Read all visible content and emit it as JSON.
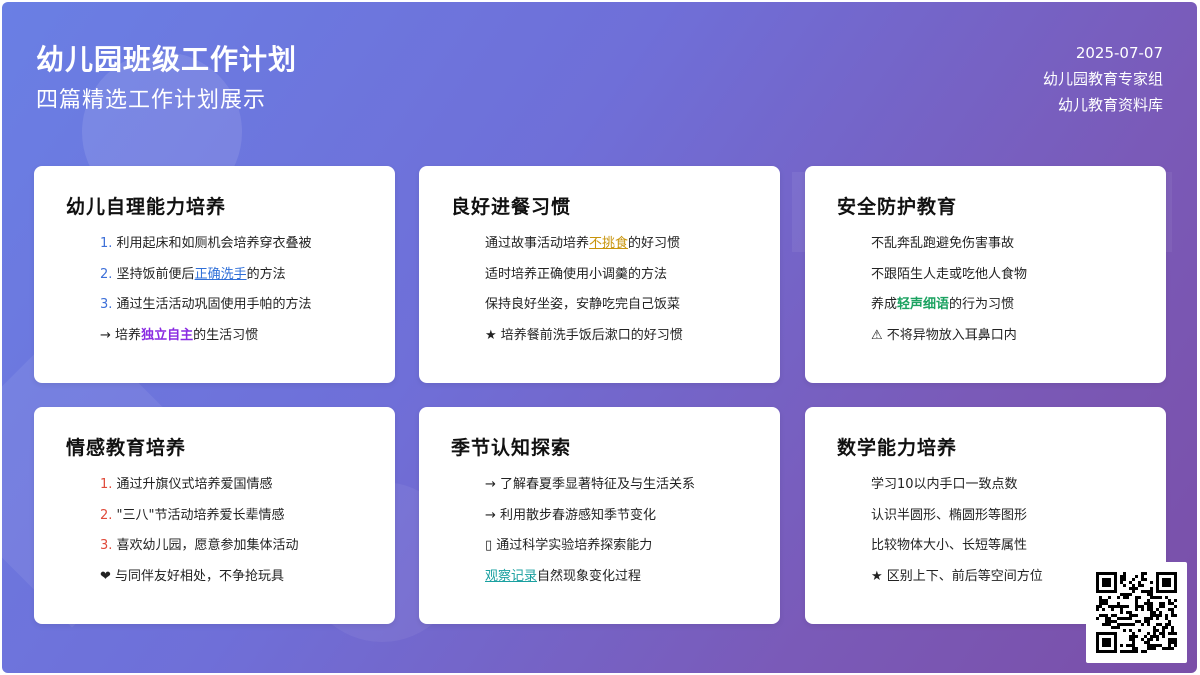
{
  "header": {
    "title": "幼儿园班级工作计划",
    "subtitle": "四篇精选工作计划展示",
    "date": "2025-07-07",
    "author": "幼儿园教育专家组",
    "source": "幼儿教育资料库"
  },
  "cards": [
    {
      "title": "幼儿自理能力培养",
      "items": [
        {
          "prefix": "1.",
          "text": "利用起床和如厕机会培养穿衣叠被"
        },
        {
          "prefix": "2.",
          "pre": "坚持饭前便后",
          "hl": "正确洗手",
          "post": "的方法"
        },
        {
          "prefix": "3.",
          "text": "通过生活活动巩固使用手帕的方法"
        },
        {
          "prefix": "→",
          "pre": "培养",
          "hl": "独立自主",
          "post": "的生活习惯"
        }
      ]
    },
    {
      "title": "良好进餐习惯",
      "items": [
        {
          "pre": "通过故事活动培养",
          "hl": "不挑食",
          "post": "的好习惯"
        },
        {
          "text": "适时培养正确使用小调羹的方法"
        },
        {
          "text": "保持良好坐姿，安静吃完自己饭菜"
        },
        {
          "prefix": "★",
          "text": "培养餐前洗手饭后漱口的好习惯"
        }
      ]
    },
    {
      "title": "安全防护教育",
      "items": [
        {
          "text": "不乱奔乱跑避免伤害事故"
        },
        {
          "text": "不跟陌生人走或吃他人食物"
        },
        {
          "pre": "养成",
          "hl": "轻声细语",
          "post": "的行为习惯"
        },
        {
          "prefix": "⚠",
          "text": "不将异物放入耳鼻口内"
        }
      ]
    },
    {
      "title": "情感教育培养",
      "items": [
        {
          "prefix": "1.",
          "text": "通过升旗仪式培养爱国情感"
        },
        {
          "prefix": "2.",
          "text": "\"三八\"节活动培养爱长辈情感"
        },
        {
          "prefix": "3.",
          "text": "喜欢幼儿园，愿意参加集体活动"
        },
        {
          "prefix": "❤",
          "text": "与同伴友好相处，不争抢玩具"
        }
      ]
    },
    {
      "title": "季节认知探索",
      "items": [
        {
          "prefix": "→",
          "text": "了解春夏季显著特征及与生活关系"
        },
        {
          "prefix": "→",
          "text": "利用散步春游感知季节变化"
        },
        {
          "prefix": "▯",
          "text": "通过科学实验培养探索能力"
        },
        {
          "hl": "观察记录",
          "post": "自然现象变化过程"
        }
      ]
    },
    {
      "title": "数学能力培养",
      "items": [
        {
          "text": "学习10以内手口一致点数"
        },
        {
          "text": "认识半圆形、椭圆形等图形"
        },
        {
          "text": "比较物体大小、长短等属性"
        },
        {
          "prefix": "★",
          "text": "区别上下、前后等空间方位"
        }
      ]
    }
  ],
  "qr": {
    "icon": "qr-code-icon"
  }
}
